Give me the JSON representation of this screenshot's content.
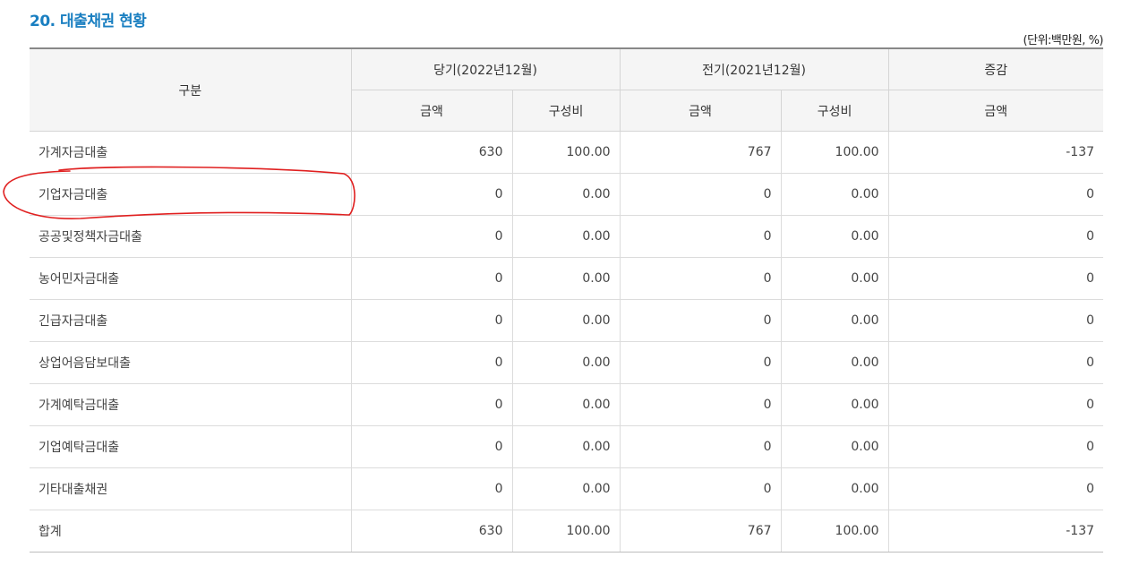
{
  "title": "20. 대출채권 현황",
  "unit": "(단위:백만원, %)",
  "headers": {
    "category": "구분",
    "current_period": "당기(2022년12월)",
    "prior_period": "전기(2021년12월)",
    "change": "증감",
    "amount": "금액",
    "ratio": "구성비"
  },
  "rows": [
    {
      "label": "가계자금대출",
      "cur_amount": "630",
      "cur_ratio": "100.00",
      "prev_amount": "767",
      "prev_ratio": "100.00",
      "change": "-137"
    },
    {
      "label": "기업자금대출",
      "cur_amount": "0",
      "cur_ratio": "0.00",
      "prev_amount": "0",
      "prev_ratio": "0.00",
      "change": "0"
    },
    {
      "label": "공공및정책자금대출",
      "cur_amount": "0",
      "cur_ratio": "0.00",
      "prev_amount": "0",
      "prev_ratio": "0.00",
      "change": "0"
    },
    {
      "label": "농어민자금대출",
      "cur_amount": "0",
      "cur_ratio": "0.00",
      "prev_amount": "0",
      "prev_ratio": "0.00",
      "change": "0"
    },
    {
      "label": "긴급자금대출",
      "cur_amount": "0",
      "cur_ratio": "0.00",
      "prev_amount": "0",
      "prev_ratio": "0.00",
      "change": "0"
    },
    {
      "label": "상업어음담보대출",
      "cur_amount": "0",
      "cur_ratio": "0.00",
      "prev_amount": "0",
      "prev_ratio": "0.00",
      "change": "0"
    },
    {
      "label": "가계예탁금대출",
      "cur_amount": "0",
      "cur_ratio": "0.00",
      "prev_amount": "0",
      "prev_ratio": "0.00",
      "change": "0"
    },
    {
      "label": "기업예탁금대출",
      "cur_amount": "0",
      "cur_ratio": "0.00",
      "prev_amount": "0",
      "prev_ratio": "0.00",
      "change": "0"
    },
    {
      "label": "기타대출채권",
      "cur_amount": "0",
      "cur_ratio": "0.00",
      "prev_amount": "0",
      "prev_ratio": "0.00",
      "change": "0"
    },
    {
      "label": "합계",
      "cur_amount": "630",
      "cur_ratio": "100.00",
      "prev_amount": "767",
      "prev_ratio": "100.00",
      "change": "-137"
    }
  ],
  "annotation_color": "#e02020"
}
